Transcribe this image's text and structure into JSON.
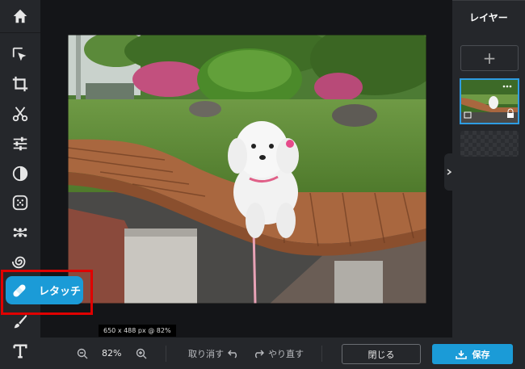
{
  "toolbar": {
    "items": [
      {
        "icon": "home-icon"
      },
      {
        "icon": "arrange-icon"
      },
      {
        "icon": "crop-icon"
      },
      {
        "icon": "cutout-icon"
      },
      {
        "icon": "adjust-icon"
      },
      {
        "icon": "effect-icon"
      },
      {
        "icon": "filter-icon"
      },
      {
        "icon": "liquify-icon"
      },
      {
        "icon": "distort-icon"
      },
      {
        "icon": "retouch-icon"
      },
      {
        "icon": "draw-icon"
      },
      {
        "icon": "text-icon"
      }
    ],
    "active": {
      "icon": "bandage-icon",
      "label": "レタッチ"
    }
  },
  "canvas": {
    "size_info": "650 x 488 px @ 82%"
  },
  "panel": {
    "title": "レイヤー",
    "add_label": "+"
  },
  "bottombar": {
    "zoom": "82%",
    "undo_label": "取り消す",
    "redo_label": "やり直す",
    "close_label": "閉じる",
    "save_label": "保存"
  },
  "colors": {
    "accent": "#1b9bd7",
    "highlight_frame": "#e00000",
    "background": "#25272b",
    "canvas_bg": "#141518"
  }
}
